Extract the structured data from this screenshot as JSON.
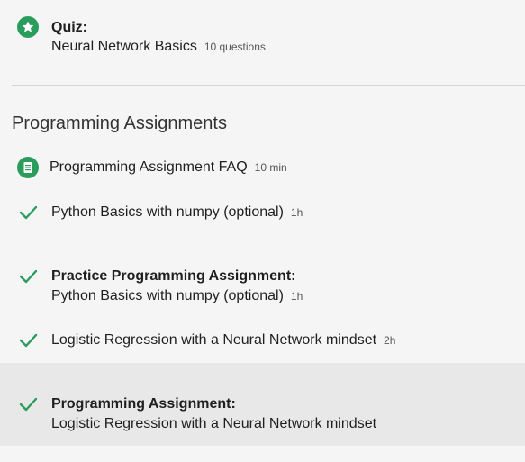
{
  "quiz": {
    "heading": "Quiz:",
    "title": "Neural Network Basics",
    "meta": "10 questions",
    "icon": "star-icon"
  },
  "section": {
    "title": "Programming Assignments"
  },
  "items": [
    {
      "title": "Programming Assignment FAQ",
      "meta": "10 min",
      "icon": "reading-icon"
    },
    {
      "title": "Python Basics with numpy (optional)",
      "meta": "1h",
      "icon": "checkmark-icon"
    },
    {
      "heading": "Practice Programming Assignment:",
      "title": "Python Basics with numpy (optional)",
      "meta": "1h",
      "icon": "checkmark-icon"
    },
    {
      "title": "Logistic Regression with a Neural Network mindset",
      "meta": "2h",
      "icon": "checkmark-icon"
    },
    {
      "heading": "Programming Assignment:",
      "title": "Logistic Regression with a Neural Network mindset",
      "icon": "checkmark-icon"
    }
  ],
  "colors": {
    "accent": "#2a9d5c",
    "check": "#2a9d5c",
    "highlight": "#e8e8e8"
  }
}
